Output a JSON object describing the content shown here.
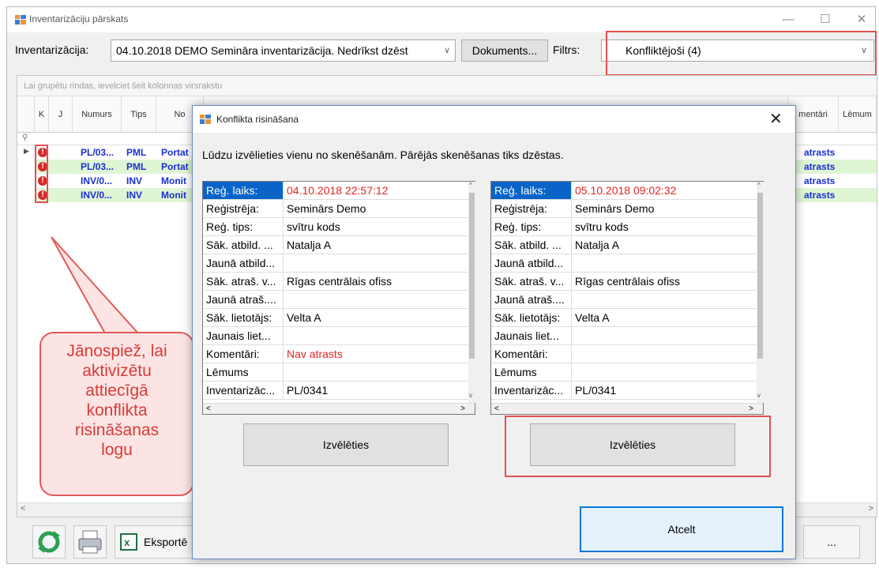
{
  "window": {
    "title": "Inventarizāciju pārskats",
    "minimize": "—",
    "maximize": "☐",
    "close": "✕"
  },
  "toolbar": {
    "inventory_label": "Inventarizācija:",
    "inventory_value": "04.10.2018 DEMO Semināra inventarizācija. Nedrīkst dzēst",
    "documents_button": "Dokuments...",
    "filter_label": "Filtrs:",
    "filter_value": "Konfliktējoši (4)"
  },
  "grid": {
    "group_hint": "Lai grupētu rindas, ievelciet šeit kolonnas virsrakstu",
    "headers": [
      "K",
      "J",
      "Numurs",
      "Tips",
      "No",
      "mentāri",
      "Lēmum"
    ],
    "rows": [
      {
        "numurs": "PL/03...",
        "tips": "PML",
        "name": "Portat",
        "komentari": "atrasts"
      },
      {
        "numurs": "PL/03...",
        "tips": "PML",
        "name": "Portat",
        "komentari": "atrasts"
      },
      {
        "numurs": "INV/0...",
        "tips": "INV",
        "name": "Monit",
        "komentari": "atrasts"
      },
      {
        "numurs": "INV/0...",
        "tips": "INV",
        "name": "Monit",
        "komentari": "atrasts"
      }
    ]
  },
  "bottombar": {
    "export_label": "Eksportē",
    "more_button": "..."
  },
  "callout": {
    "text": [
      "Jānospiež, lai",
      "aktivizētu",
      "attiecīgā",
      "konflikta",
      "risināšanas",
      "logu"
    ]
  },
  "dialog": {
    "title": "Konflikta risināšana",
    "close": "✕",
    "instruction": "Lūdzu izvēlieties vienu no skenēšanām. Pārējās skenēšanas tiks dzēstas.",
    "left": {
      "rows": [
        {
          "key": "Reģ. laiks:",
          "value": "04.10.2018 22:57:12"
        },
        {
          "key": "Reģistrēja:",
          "value": "Seminārs Demo"
        },
        {
          "key": "Reģ. tips:",
          "value": "svītru kods"
        },
        {
          "key": "Sāk. atbild. ...",
          "value": "Natalja A"
        },
        {
          "key": "Jaunā atbild...",
          "value": ""
        },
        {
          "key": "Sāk. atraš. v...",
          "value": "Rīgas centrālais ofiss"
        },
        {
          "key": "Jaunā atraš....",
          "value": ""
        },
        {
          "key": "Sāk. lietotājs:",
          "value": "Velta A"
        },
        {
          "key": "Jaunais liet...",
          "value": ""
        },
        {
          "key": "Komentāri:",
          "value": "Nav atrasts"
        },
        {
          "key": "Lēmums",
          "value": ""
        },
        {
          "key": "Inventarizāc...",
          "value": "PL/0341"
        }
      ],
      "button": "Izvēlēties"
    },
    "right": {
      "rows": [
        {
          "key": "Reģ. laiks:",
          "value": "05.10.2018 09:02:32"
        },
        {
          "key": "Reģistrēja:",
          "value": "Seminārs Demo"
        },
        {
          "key": "Reģ. tips:",
          "value": "svītru kods"
        },
        {
          "key": "Sāk. atbild. ...",
          "value": "Natalja A"
        },
        {
          "key": "Jaunā atbild...",
          "value": ""
        },
        {
          "key": "Sāk. atraš. v...",
          "value": "Rīgas centrālais ofiss"
        },
        {
          "key": "Jaunā atraš....",
          "value": ""
        },
        {
          "key": "Sāk. lietotājs:",
          "value": "Velta A"
        },
        {
          "key": "Jaunais liet...",
          "value": ""
        },
        {
          "key": "Komentāri:",
          "value": ""
        },
        {
          "key": "Lēmums",
          "value": ""
        },
        {
          "key": "Inventarizāc...",
          "value": "PL/0341"
        }
      ],
      "button": "Izvēlēties"
    },
    "cancel_button": "Atcelt"
  },
  "colors": {
    "accent": "#0078d7",
    "highlight_red": "#e0524f",
    "link_blue": "#1a2fd2",
    "row_green": "#dff6d5",
    "selected_key": "#0a64c8",
    "red_text": "#e32424"
  }
}
